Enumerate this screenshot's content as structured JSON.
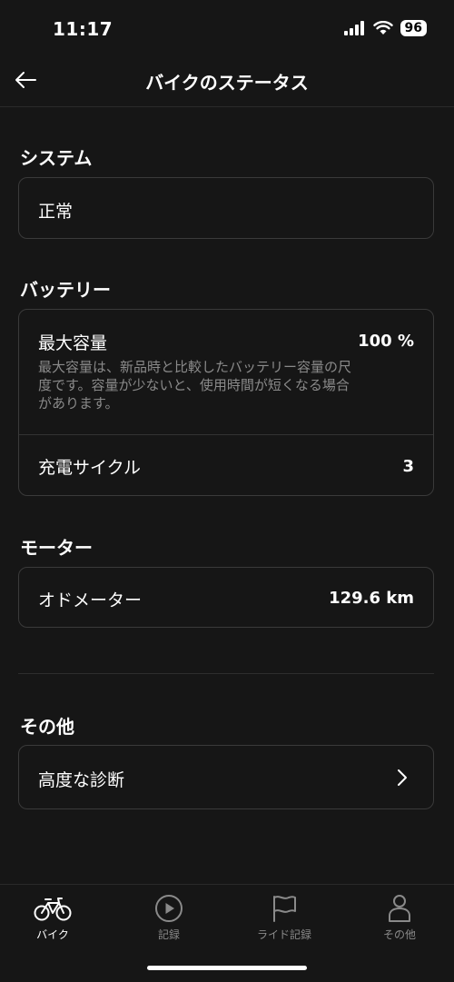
{
  "status_bar": {
    "time": "11:17",
    "battery": "96"
  },
  "header": {
    "title": "バイクのステータス"
  },
  "system": {
    "title": "システム",
    "value": "正常"
  },
  "battery": {
    "title": "バッテリー",
    "max_capacity_label": "最大容量",
    "max_capacity_value": "100 %",
    "max_capacity_desc_1": "最大容量は、新品時と比較したバッテリー容量の尺",
    "max_capacity_desc_2": "度です。容量が少ないと、使用時間が短くなる場合",
    "max_capacity_desc_3": "があります。",
    "cycles_label": "充電サイクル",
    "cycles_value": "3"
  },
  "motor": {
    "title": "モーター",
    "odometer_label": "オドメーター",
    "odometer_value": "129.6 km"
  },
  "other": {
    "title": "その他",
    "advanced_label": "高度な診断"
  },
  "tabs": [
    {
      "label": "バイク",
      "icon": "bike-icon",
      "active": true
    },
    {
      "label": "記録",
      "icon": "play-circle-icon",
      "active": false
    },
    {
      "label": "ライド記録",
      "icon": "flag-icon",
      "active": false
    },
    {
      "label": "その他",
      "icon": "person-icon",
      "active": false
    }
  ]
}
